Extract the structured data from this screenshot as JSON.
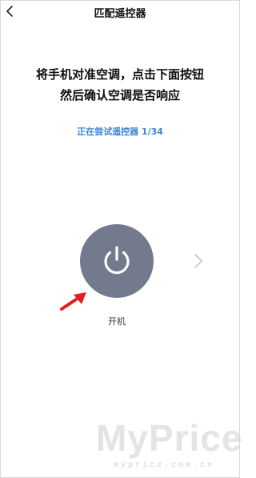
{
  "header": {
    "title": "匹配遥控器",
    "back_icon": "chevron-left-icon"
  },
  "instruction": {
    "line1": "将手机对准空调，点击下面按钮",
    "line2": "然后确认空调是否响应"
  },
  "status": {
    "trying_text": "正在尝试遥控器 1/34"
  },
  "power": {
    "icon": "power-icon",
    "label": "开机",
    "button_color": "#737a8d"
  },
  "next": {
    "icon": "chevron-right-icon"
  },
  "annotation": {
    "icon": "red-arrow-icon",
    "color": "#e0201b"
  },
  "watermark": {
    "brand": "MyPrice",
    "url": "myprice.com.cn"
  },
  "colors": {
    "accent_blue": "#3b86d6"
  }
}
